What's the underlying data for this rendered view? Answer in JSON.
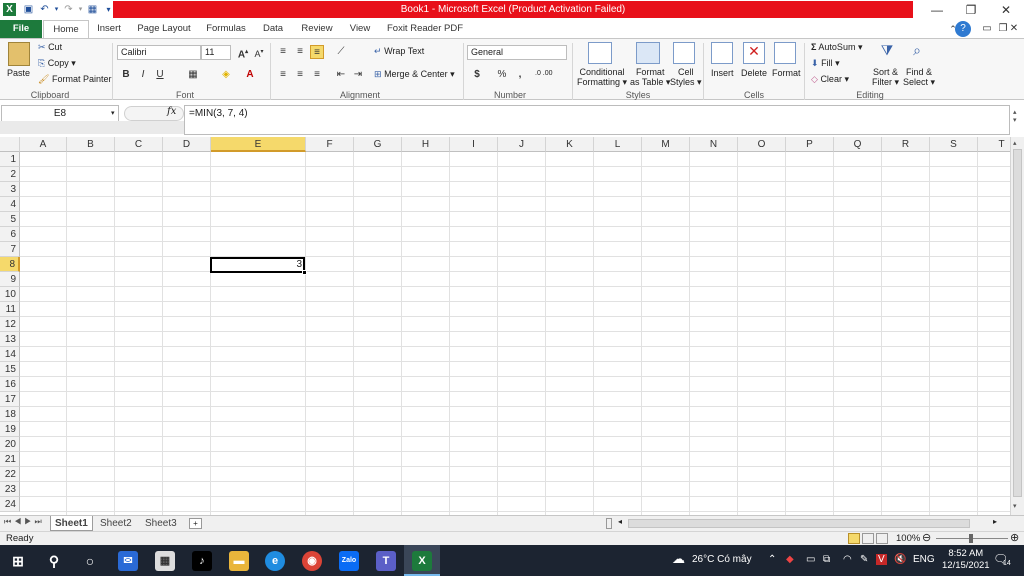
{
  "window": {
    "title": "Book1 - Microsoft Excel (Product Activation Failed)"
  },
  "tabs": [
    "File",
    "Home",
    "Insert",
    "Page Layout",
    "Formulas",
    "Data",
    "Review",
    "View",
    "Foxit Reader PDF"
  ],
  "clipboard": {
    "paste": "Paste",
    "cut": "Cut",
    "copy": "Copy",
    "format_painter": "Format Painter",
    "label": "Clipboard"
  },
  "font": {
    "name": "Calibri",
    "size": "11",
    "bold": "B",
    "italic": "I",
    "underline": "U",
    "label": "Font"
  },
  "alignment": {
    "wrap": "Wrap Text",
    "merge": "Merge & Center",
    "label": "Alignment"
  },
  "number": {
    "format": "General",
    "currency": "$",
    "percent": "%",
    "comma": ",",
    "inc": ".0 .00",
    "label": "Number"
  },
  "styles": {
    "conditional_1": "Conditional",
    "conditional_2": "Formatting",
    "format_table_1": "Format",
    "format_table_2": "as Table",
    "cell_styles_1": "Cell",
    "cell_styles_2": "Styles",
    "label": "Styles"
  },
  "cells": {
    "insert": "Insert",
    "delete": "Delete",
    "format": "Format",
    "label": "Cells"
  },
  "editing": {
    "autosum": "AutoSum",
    "fill": "Fill",
    "clear": "Clear",
    "sort_1": "Sort &",
    "sort_2": "Filter",
    "find_1": "Find &",
    "find_2": "Select",
    "label": "Editing"
  },
  "formula_bar": {
    "name_box": "E8",
    "fx": "fx",
    "formula": "=MIN(3, 7, 4)"
  },
  "columns": [
    "A",
    "B",
    "C",
    "D",
    "E",
    "F",
    "G",
    "H",
    "I",
    "J",
    "K",
    "L",
    "M",
    "N",
    "O",
    "P",
    "Q",
    "R",
    "S",
    "T"
  ],
  "rows": [
    "1",
    "2",
    "3",
    "4",
    "5",
    "6",
    "7",
    "8",
    "9",
    "10",
    "11",
    "12",
    "13",
    "14",
    "15",
    "16",
    "17",
    "18",
    "19",
    "20",
    "21",
    "22",
    "23",
    "24"
  ],
  "active_cell": {
    "ref": "E8",
    "value": "3"
  },
  "sheets": [
    "Sheet1",
    "Sheet2",
    "Sheet3"
  ],
  "status": {
    "mode": "Ready",
    "zoom": "100%"
  },
  "taskbar": {
    "weather": "26°C  Có mây",
    "lang": "ENG",
    "time": "8:52 AM",
    "date": "12/15/2021",
    "notif": "14"
  },
  "colors": {
    "title_red": "#e8101a",
    "file_green": "#1d7a3c",
    "selected_header": "#f5d96b",
    "taskbar": "#1c2431"
  }
}
